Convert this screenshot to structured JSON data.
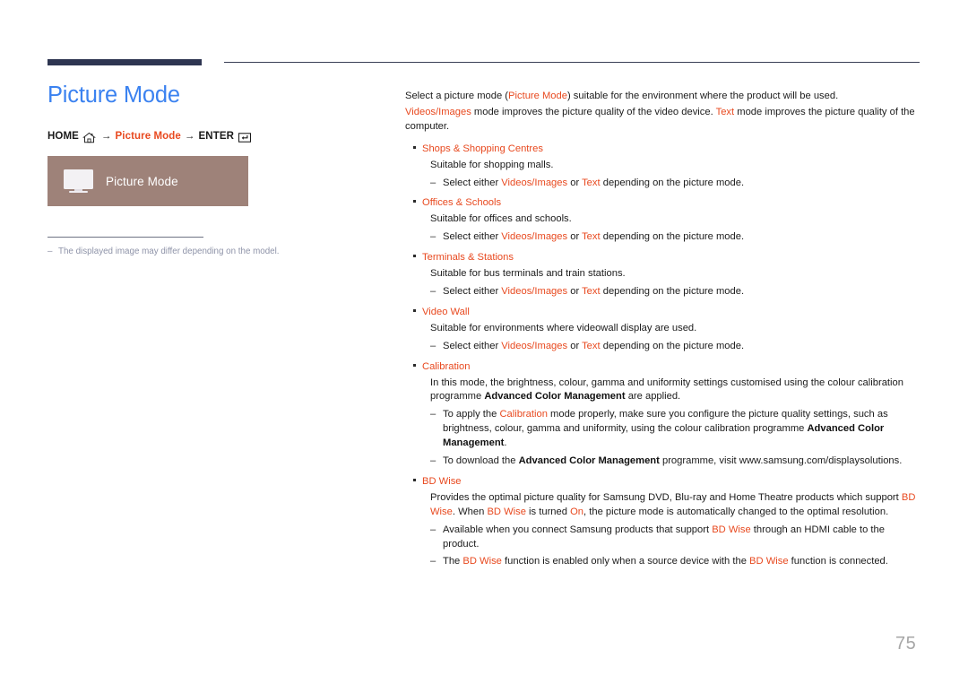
{
  "document": {
    "page_number": "75",
    "title": "Picture Mode",
    "title_color": "#3b82f0",
    "accent_color": "#e8491f",
    "panel_color": "#9e8279",
    "rule_color": "#2e3551"
  },
  "breadcrumb": {
    "home_label": "HOME",
    "home_icon": "home-icon",
    "arrow": "→",
    "middle_label": "Picture Mode",
    "enter_label": "ENTER",
    "enter_icon": "enter-key-icon"
  },
  "menu_panel": {
    "icon": "monitor-icon",
    "label": "Picture Mode"
  },
  "footnote": {
    "dash": "‒",
    "text": "The displayed image may differ depending on the model."
  },
  "content": {
    "intro": [
      {
        "id": "p1",
        "runs": [
          {
            "t": "Select a picture mode (",
            "s": "plain"
          },
          {
            "t": "Picture Mode",
            "s": "accent"
          },
          {
            "t": ") suitable for the environment where the product will be used.",
            "s": "plain"
          }
        ]
      },
      {
        "id": "p2",
        "runs": [
          {
            "t": "Videos/Images",
            "s": "accent"
          },
          {
            "t": " mode improves the picture quality of the video device. ",
            "s": "plain"
          },
          {
            "t": "Text",
            "s": "accent"
          },
          {
            "t": " mode improves the picture quality of the computer.",
            "s": "plain"
          }
        ]
      }
    ],
    "bullets": [
      {
        "title": "Shops & Shopping Centres",
        "body": [
          {
            "t": "Suitable for shopping malls.",
            "s": "plain"
          }
        ],
        "subs": [
          {
            "runs": [
              {
                "t": "Select either ",
                "s": "plain"
              },
              {
                "t": "Videos/Images",
                "s": "accent"
              },
              {
                "t": " or ",
                "s": "plain"
              },
              {
                "t": "Text",
                "s": "accent"
              },
              {
                "t": " depending on the picture mode.",
                "s": "plain"
              }
            ]
          }
        ]
      },
      {
        "title": "Offices & Schools",
        "body": [
          {
            "t": "Suitable for offices and schools.",
            "s": "plain"
          }
        ],
        "subs": [
          {
            "runs": [
              {
                "t": "Select either ",
                "s": "plain"
              },
              {
                "t": "Videos/Images",
                "s": "accent"
              },
              {
                "t": " or ",
                "s": "plain"
              },
              {
                "t": "Text",
                "s": "accent"
              },
              {
                "t": " depending on the picture mode.",
                "s": "plain"
              }
            ]
          }
        ]
      },
      {
        "title": "Terminals & Stations",
        "body": [
          {
            "t": "Suitable for bus terminals and train stations.",
            "s": "plain"
          }
        ],
        "subs": [
          {
            "runs": [
              {
                "t": "Select either ",
                "s": "plain"
              },
              {
                "t": "Videos/Images",
                "s": "accent"
              },
              {
                "t": " or ",
                "s": "plain"
              },
              {
                "t": "Text",
                "s": "accent"
              },
              {
                "t": " depending on the picture mode.",
                "s": "plain"
              }
            ]
          }
        ]
      },
      {
        "title": "Video Wall",
        "body": [
          {
            "t": "Suitable for environments where videowall display are used.",
            "s": "plain"
          }
        ],
        "subs": [
          {
            "runs": [
              {
                "t": "Select either ",
                "s": "plain"
              },
              {
                "t": "Videos/Images",
                "s": "accent"
              },
              {
                "t": " or ",
                "s": "plain"
              },
              {
                "t": "Text",
                "s": "accent"
              },
              {
                "t": " depending on the picture mode.",
                "s": "plain"
              }
            ]
          }
        ]
      },
      {
        "title": "Calibration",
        "body": [
          {
            "t": "In this mode, the brightness, colour, gamma and uniformity settings customised using the colour calibration programme ",
            "s": "plain"
          },
          {
            "t": "Advanced Color Management",
            "s": "bold"
          },
          {
            "t": " are applied.",
            "s": "plain"
          }
        ],
        "subs": [
          {
            "runs": [
              {
                "t": "To apply the ",
                "s": "plain"
              },
              {
                "t": "Calibration",
                "s": "accent"
              },
              {
                "t": " mode properly, make sure you configure the picture quality settings, such as brightness, colour, gamma and uniformity, using the colour calibration programme ",
                "s": "plain"
              },
              {
                "t": "Advanced Color Management",
                "s": "bold"
              },
              {
                "t": ".",
                "s": "plain"
              }
            ]
          },
          {
            "runs": [
              {
                "t": "To download the ",
                "s": "plain"
              },
              {
                "t": "Advanced Color Management",
                "s": "bold"
              },
              {
                "t": " programme, visit www.samsung.com/displaysolutions.",
                "s": "plain"
              }
            ]
          }
        ]
      },
      {
        "title": "BD Wise",
        "body": [
          {
            "t": "Provides the optimal picture quality for Samsung DVD, Blu-ray and Home Theatre products which support ",
            "s": "plain"
          },
          {
            "t": "BD Wise",
            "s": "accent"
          },
          {
            "t": ". When ",
            "s": "plain"
          },
          {
            "t": "BD Wise",
            "s": "accent"
          },
          {
            "t": " is turned ",
            "s": "plain"
          },
          {
            "t": "On",
            "s": "accent"
          },
          {
            "t": ", the picture mode is automatically changed to the optimal resolution.",
            "s": "plain"
          }
        ],
        "subs": [
          {
            "runs": [
              {
                "t": "Available when you connect Samsung products that support ",
                "s": "plain"
              },
              {
                "t": "BD Wise",
                "s": "accent"
              },
              {
                "t": " through an HDMI cable to the product.",
                "s": "plain"
              }
            ]
          },
          {
            "runs": [
              {
                "t": "The ",
                "s": "plain"
              },
              {
                "t": "BD Wise",
                "s": "accent"
              },
              {
                "t": " function is enabled only when a source device with the ",
                "s": "plain"
              },
              {
                "t": "BD Wise",
                "s": "accent"
              },
              {
                "t": " function is connected.",
                "s": "plain"
              }
            ]
          }
        ]
      }
    ]
  }
}
